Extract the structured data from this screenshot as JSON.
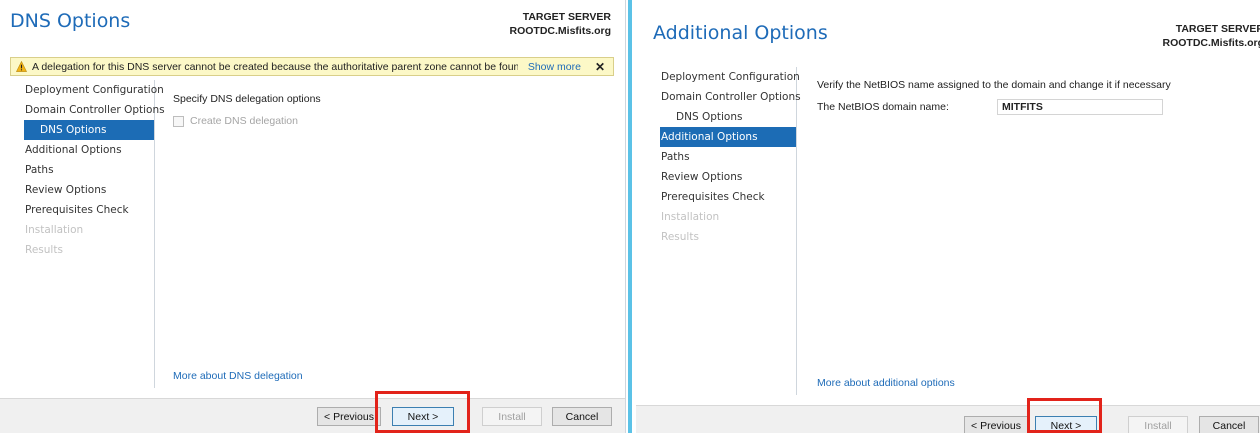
{
  "left": {
    "title": "DNS Options",
    "target_server_label": "TARGET SERVER",
    "target_server_name": "ROOTDC.Misfits.org",
    "warning": {
      "text": "A delegation for this DNS server cannot be created because the authoritative parent zone cannot be found...",
      "link": "Show more",
      "close": "✕"
    },
    "nav": [
      {
        "label": "Deployment Configuration",
        "state": "normal"
      },
      {
        "label": "Domain Controller Options",
        "state": "normal"
      },
      {
        "label": "DNS Options",
        "state": "active-sub"
      },
      {
        "label": "Additional Options",
        "state": "normal"
      },
      {
        "label": "Paths",
        "state": "normal"
      },
      {
        "label": "Review Options",
        "state": "normal"
      },
      {
        "label": "Prerequisites Check",
        "state": "normal"
      },
      {
        "label": "Installation",
        "state": "disabled"
      },
      {
        "label": "Results",
        "state": "disabled"
      }
    ],
    "heading": "Specify DNS delegation options",
    "checkbox_label": "Create DNS delegation",
    "more_link": "More about DNS delegation",
    "buttons": {
      "previous": "< Previous",
      "next": "Next >",
      "install": "Install",
      "cancel": "Cancel"
    }
  },
  "right": {
    "title": "Additional Options",
    "target_server_label": "TARGET SERVER",
    "target_server_name": "ROOTDC.Misfits.org",
    "nav": [
      {
        "label": "Deployment Configuration",
        "state": "normal"
      },
      {
        "label": "Domain Controller Options",
        "state": "normal"
      },
      {
        "label": "DNS Options",
        "state": "sub"
      },
      {
        "label": "Additional Options",
        "state": "active"
      },
      {
        "label": "Paths",
        "state": "normal"
      },
      {
        "label": "Review Options",
        "state": "normal"
      },
      {
        "label": "Prerequisites Check",
        "state": "normal"
      },
      {
        "label": "Installation",
        "state": "disabled"
      },
      {
        "label": "Results",
        "state": "disabled"
      }
    ],
    "heading": "Verify the NetBIOS name assigned to the domain and change it if necessary",
    "field_label": "The NetBIOS domain name:",
    "field_value": "MITFITS",
    "more_link": "More about additional options",
    "buttons": {
      "previous": "< Previous",
      "next": "Next >",
      "install": "Install",
      "cancel": "Cancel"
    }
  },
  "colors": {
    "accent": "#1c6cb5",
    "highlight": "#e2231a",
    "warning_bg": "#fcf8c7",
    "divider": "#5bc2e7"
  },
  "icons": {
    "warning": "warning-triangle-icon",
    "close": "close-icon"
  }
}
